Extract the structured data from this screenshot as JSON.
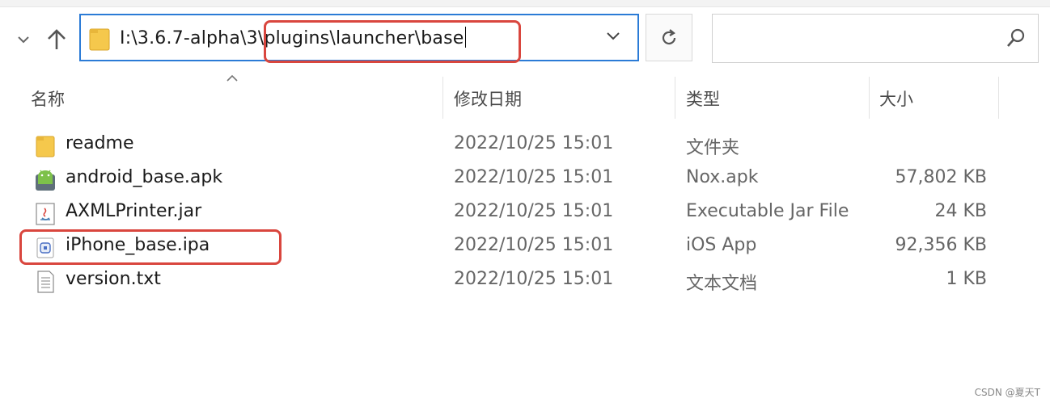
{
  "nav": {
    "back_icon": "chevron-down-icon",
    "up_icon": "arrow-up-icon"
  },
  "address_bar": {
    "path_prefix": "I:\\3.6.7-alpha\\3\\",
    "path_highlighted": "plugins\\launcher\\base",
    "dropdown_icon": "chevron-down-icon",
    "folder_icon": "folder-icon"
  },
  "refresh": {
    "icon": "refresh-icon"
  },
  "search": {
    "placeholder": "",
    "value": "",
    "icon": "search-icon"
  },
  "columns": {
    "name": "名称",
    "modified": "修改日期",
    "type": "类型",
    "size": "大小"
  },
  "files": [
    {
      "name": "readme",
      "modified": "2022/10/25 15:01",
      "type": "文件夹",
      "size": "",
      "icon": "folder-icon"
    },
    {
      "name": "android_base.apk",
      "modified": "2022/10/25 15:01",
      "type": "Nox.apk",
      "size": "57,802 KB",
      "icon": "android-apk-icon"
    },
    {
      "name": "AXMLPrinter.jar",
      "modified": "2022/10/25 15:01",
      "type": "Executable Jar File",
      "size": "24 KB",
      "icon": "java-jar-icon"
    },
    {
      "name": "iPhone_base.ipa",
      "modified": "2022/10/25 15:01",
      "type": "iOS App",
      "size": "92,356 KB",
      "icon": "ios-app-icon"
    },
    {
      "name": "version.txt",
      "modified": "2022/10/25 15:01",
      "type": "文本文档",
      "size": "1 KB",
      "icon": "text-file-icon"
    }
  ],
  "annotations": {
    "highlight_color": "#d9463e"
  },
  "watermark": "CSDN @夏天T",
  "colors": {
    "accent": "#2b7bd6",
    "folder": "#f5c84c"
  }
}
